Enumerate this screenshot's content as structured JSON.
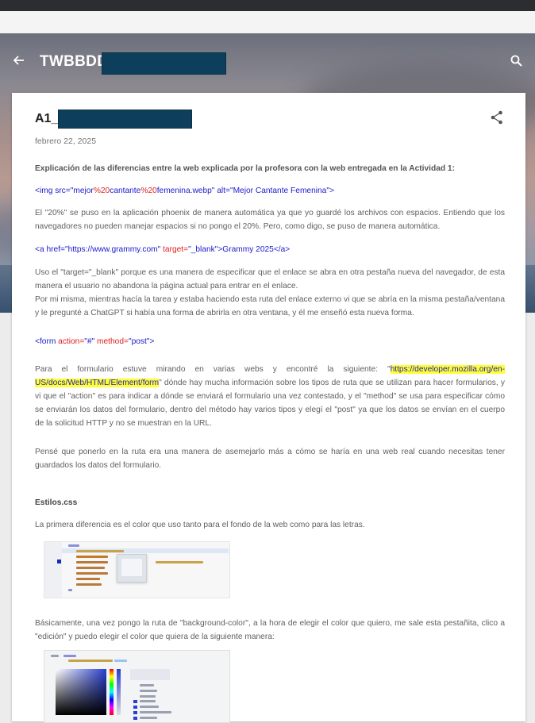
{
  "header": {
    "blog_title": "TWBBDD_"
  },
  "post": {
    "title": "A1_",
    "date": "febrero 22, 2025",
    "intro": "Explicación de las diferencias entre la web explicada por la profesora con la web entregada en la Actividad 1:",
    "code_img": {
      "p1": "<img src=\"mejor",
      "p2": "%20",
      "p3": "cantante",
      "p4": "%20",
      "p5": "femenina.webp\" alt=\"Mejor Cantante Femenina\">"
    },
    "para_20": "El \"20%\" se puso en la aplicación phoenix de manera automática ya que yo guardé los archivos con espacios. Entiendo que los navegadores no pueden manejar espacios si no pongo el 20%. Pero, como digo, se puso de manera automática.",
    "code_a": {
      "p1": "<a href=\"https://www.grammy.com\"",
      "p2": " target=",
      "p3": "\"_blank\"",
      "p4": ">Grammy 2025</a>"
    },
    "para_blank_1": "Uso el \"target=\"_blank\" porque es una manera de especificar que el enlace se abra en otra pestaña nueva del navegador, de esta manera el usuario no abandona la página actual para entrar en el enlace.",
    "para_blank_2": "Por mi misma, mientras hacía la tarea y estaba haciendo esta ruta del enlace externo vi que se abría en la misma pestaña/ventana y le pregunté a ChatGPT si había una forma de abrirla en otra ventana, y él me enseñó esta nueva forma.",
    "code_form": {
      "p1": "<form",
      "p2": " action=",
      "p3": "\"#\"",
      "p4": " method=",
      "p5": "\"post\"",
      "p6": ">"
    },
    "para_form_pre": "Para el formulario estuve mirando en varias webs y encontré la siguiente: \"",
    "para_form_link": "https://developer.mozilla.org/en-US/docs/Web/HTML/Element/form",
    "para_form_post": "\" dónde hay mucha información sobre los tipos de ruta que se utilizan para hacer formularios, y vi que el \"action\" es para indicar a dónde se enviará el formulario una vez contestado, y el \"method\" se usa para especificar cómo se enviarán los datos del formulario, dentro del método hay varios tipos y elegí el \"post\" ya que los datos se envían en el cuerpo de la solicitud HTTP y no se muestran en la URL.",
    "para_pense": "Pensé que ponerlo en la ruta era una manera de asemejarlo más a cómo se haría en una web real cuando necesitas tener guardados los datos del formulario.",
    "section_css": "Estilos.css",
    "para_color": "La primera diferencia es el color que uso tanto para el fondo de la web como para las letras.",
    "para_basic": "Básicamente, una vez pongo la ruta de \"background-color\", a la hora de elegir el color que quiero, me sale esta pestañita, clico a \"edición\" y puedo elegir el color que quiera de la siguiente manera:"
  },
  "colors": {
    "code_blue": "#1a1acd",
    "code_red": "#e02020",
    "highlight": "#ffff33",
    "redaction": "#0d3f5c"
  },
  "icons": {
    "back": "arrow-left-icon",
    "search": "search-icon",
    "share": "share-icon"
  }
}
